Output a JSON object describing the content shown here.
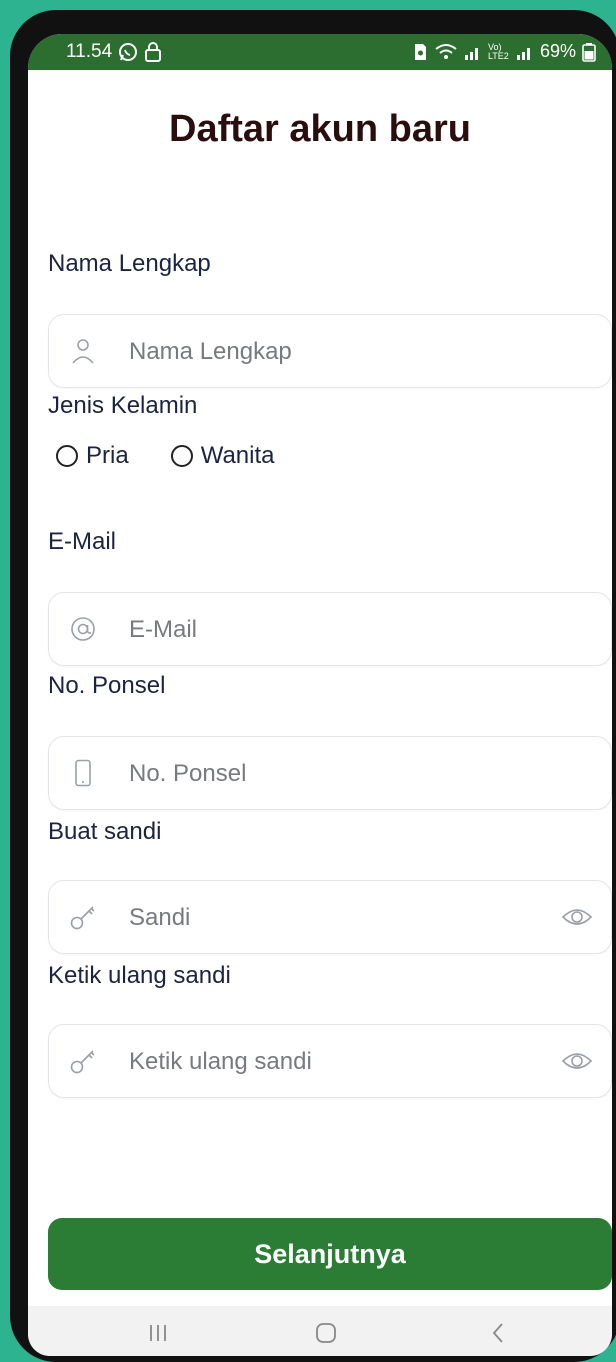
{
  "status_bar": {
    "time": "11.54",
    "battery": "69%",
    "network": "Vo) LTE2"
  },
  "page": {
    "title": "Daftar akun baru"
  },
  "form": {
    "full_name": {
      "label": "Nama Lengkap",
      "placeholder": "Nama Lengkap",
      "icon": "user-icon"
    },
    "gender": {
      "label": "Jenis Kelamin",
      "options": [
        "Pria",
        "Wanita"
      ]
    },
    "email": {
      "label": "E-Mail",
      "placeholder": "E-Mail",
      "icon": "at-icon"
    },
    "phone": {
      "label": "No. Ponsel",
      "placeholder": "No. Ponsel",
      "icon": "phone-icon"
    },
    "password": {
      "label": "Buat sandi",
      "placeholder": "Sandi",
      "icon": "key-icon"
    },
    "password_confirm": {
      "label": "Ketik ulang sandi",
      "placeholder": "Ketik ulang sandi",
      "icon": "key-icon"
    }
  },
  "actions": {
    "next_label": "Selanjutnya"
  },
  "colors": {
    "background": "#2db38f",
    "status_bar": "#2c6e2f",
    "primary_button": "#2b7c34",
    "title_text": "#2a0d0d",
    "label_text": "#1b2440"
  },
  "navigation": {
    "icons": [
      "recent-apps-icon",
      "home-icon",
      "back-icon"
    ]
  }
}
